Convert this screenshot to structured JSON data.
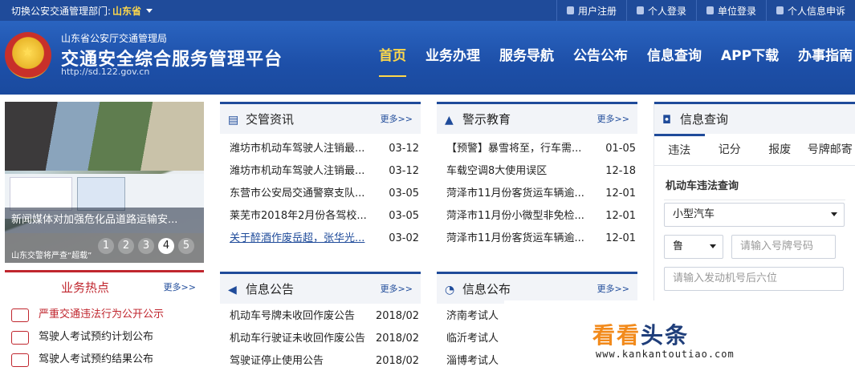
{
  "topbar": {
    "switch_label": "切换公安交通管理部门:",
    "province": "山东省",
    "links": [
      "用户注册",
      "个人登录",
      "单位登录",
      "个人信息申诉"
    ]
  },
  "header": {
    "org": "山东省公安厅交通管理局",
    "title": "交通安全综合服务管理平台",
    "url": "http://sd.122.gov.cn",
    "nav": [
      "首页",
      "业务办理",
      "服务导航",
      "公告公布",
      "信息查询",
      "APP下载",
      "办事指南"
    ]
  },
  "banner": {
    "caption": "新闻媒体对加强危化品道路运输安...",
    "subcaption": "山东交警将严查“超载”",
    "dots": [
      "1",
      "2",
      "3",
      "4",
      "5"
    ],
    "active_dot": 4
  },
  "news": {
    "title": "交管资讯",
    "more": "更多>>",
    "items": [
      {
        "text": "潍坊市机动车驾驶人注销最...",
        "date": "03-12"
      },
      {
        "text": "潍坊市机动车驾驶人注销最...",
        "date": "03-12"
      },
      {
        "text": "东营市公安局交通警察支队...",
        "date": "03-05"
      },
      {
        "text": "莱芜市2018年2月份各驾校...",
        "date": "03-05"
      },
      {
        "text": "关于醉酒作废岳超，张华光...",
        "date": "03-02"
      }
    ]
  },
  "warning": {
    "title": "警示教育",
    "more": "更多>>",
    "items": [
      {
        "text": "【预警】暴雪将至，行车需...",
        "date": "01-05"
      },
      {
        "text": "车载空调8大使用误区",
        "date": "12-18"
      },
      {
        "text": "菏泽市11月份客货运车辆逾...",
        "date": "12-01"
      },
      {
        "text": "菏泽市11月份小微型非免检...",
        "date": "12-01"
      },
      {
        "text": "菏泽市11月份客货运车辆逾...",
        "date": "12-01"
      }
    ]
  },
  "hot": {
    "title": "业务热点",
    "more": "更多>>",
    "items": [
      "严重交通违法行为公开公示",
      "驾驶人考试预约计划公布",
      "驾驶人考试预约结果公布"
    ]
  },
  "notice": {
    "title": "信息公告",
    "more": "更多>>",
    "items": [
      {
        "text": "机动车号牌未收回作废公告",
        "date": "2018/02"
      },
      {
        "text": "机动车行驶证未收回作废公告",
        "date": "2018/02"
      },
      {
        "text": "驾驶证停止使用公告",
        "date": "2018/02"
      }
    ]
  },
  "publish": {
    "title": "信息公布",
    "more": "更多>>",
    "items": [
      "济南考试人",
      "临沂考试人",
      "淄博考试人"
    ]
  },
  "query": {
    "title": "信息查询",
    "tabs": [
      "违法",
      "记分",
      "报废",
      "号牌邮寄"
    ],
    "subtitle": "机动车违法查询",
    "vehicle_type": "小型汽车",
    "plate_prefix": "鲁",
    "plate_placeholder": "请输入号牌号码",
    "engine_placeholder": "请输入发动机号后六位"
  },
  "watermark": {
    "brand_a": "看看",
    "brand_b": "头条",
    "url": "www.kankantoutiao.com"
  }
}
